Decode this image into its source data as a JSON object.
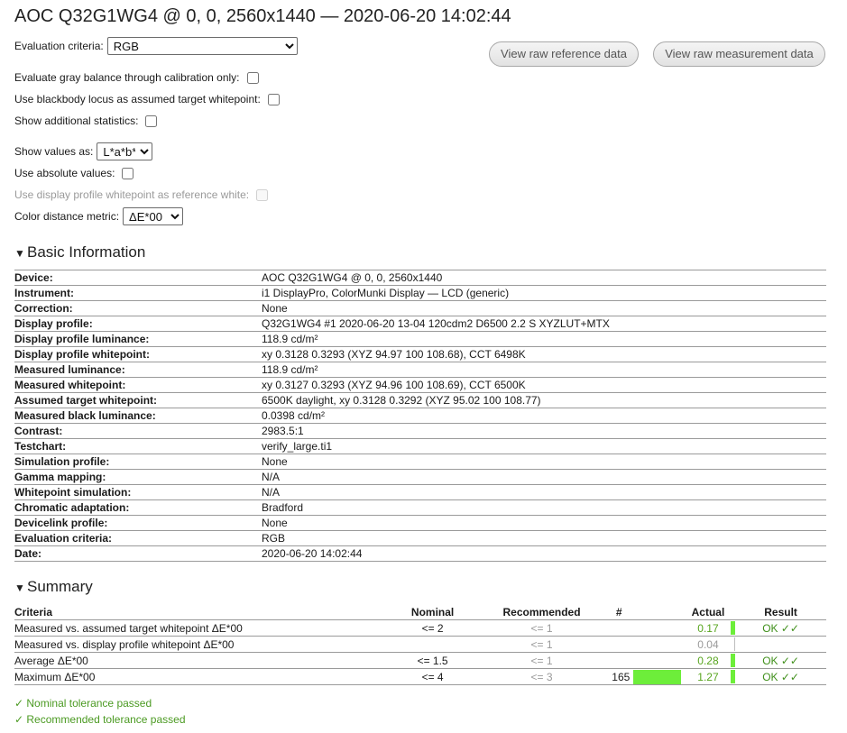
{
  "title": "AOC Q32G1WG4 @ 0, 0, 2560x1440 — 2020-06-20 14:02:44",
  "controls": {
    "evaluation_label": "Evaluation criteria:",
    "evaluation_value": "RGB",
    "gray_balance_label": "Evaluate gray balance through calibration only:",
    "blackbody_label": "Use blackbody locus as assumed target whitepoint:",
    "additional_stats_label": "Show additional statistics:",
    "show_values_label": "Show values as:",
    "show_values_value": "L*a*b*",
    "absolute_label": "Use absolute values:",
    "display_profile_wp_label": "Use display profile whitepoint as reference white:",
    "color_distance_label": "Color distance metric:",
    "color_distance_value": "ΔE*00"
  },
  "buttons": {
    "raw_reference": "View raw reference data",
    "raw_measurement": "View raw measurement data"
  },
  "basic": {
    "heading": "Basic Information",
    "rows": [
      {
        "k": "Device:",
        "v": "AOC Q32G1WG4 @ 0, 0, 2560x1440"
      },
      {
        "k": "Instrument:",
        "v": "i1 DisplayPro, ColorMunki Display — LCD (generic)"
      },
      {
        "k": "Correction:",
        "v": "None"
      },
      {
        "k": "Display profile:",
        "v": "Q32G1WG4 #1 2020-06-20 13-04 120cdm2 D6500 2.2 S XYZLUT+MTX"
      },
      {
        "k": "Display profile luminance:",
        "v": "118.9 cd/m²"
      },
      {
        "k": "Display profile whitepoint:",
        "v": "xy 0.3128 0.3293 (XYZ 94.97 100 108.68), CCT 6498K"
      },
      {
        "k": "Measured luminance:",
        "v": "118.9 cd/m²"
      },
      {
        "k": "Measured whitepoint:",
        "v": "xy 0.3127 0.3293 (XYZ 94.96 100 108.69), CCT 6500K"
      },
      {
        "k": "Assumed target whitepoint:",
        "v": "6500K daylight, xy 0.3128 0.3292 (XYZ 95.02 100 108.77)"
      },
      {
        "k": "Measured black luminance:",
        "v": "0.0398 cd/m²"
      },
      {
        "k": "Contrast:",
        "v": "2983.5:1"
      },
      {
        "k": "Testchart:",
        "v": "verify_large.ti1"
      },
      {
        "k": "Simulation profile:",
        "v": "None"
      },
      {
        "k": "Gamma mapping:",
        "v": "N/A"
      },
      {
        "k": "Whitepoint simulation:",
        "v": "N/A"
      },
      {
        "k": "Chromatic adaptation:",
        "v": "Bradford"
      },
      {
        "k": "Devicelink profile:",
        "v": "None"
      },
      {
        "k": "Evaluation criteria:",
        "v": "RGB"
      },
      {
        "k": "Date:",
        "v": "2020-06-20 14:02:44"
      }
    ]
  },
  "summary": {
    "heading": "Summary",
    "headers": {
      "criteria": "Criteria",
      "nominal": "Nominal",
      "recommended": "Recommended",
      "count": "#",
      "actual": "Actual",
      "result": "Result"
    },
    "rows": [
      {
        "criteria": "Measured vs. assumed target whitepoint ΔE*00",
        "nominal": "<= 2",
        "recommended": "<= 1",
        "count": "",
        "bar_fraction": 0,
        "actual": "0.17",
        "marker": "fill",
        "result": "OK ✓✓"
      },
      {
        "criteria": "Measured vs. display profile whitepoint ΔE*00",
        "nominal": "",
        "recommended": "<= 1",
        "count": "",
        "bar_fraction": 0,
        "actual": "0.04",
        "marker": "line",
        "result": ""
      },
      {
        "criteria": "Average ΔE*00",
        "nominal": "<= 1.5",
        "recommended": "<= 1",
        "count": "",
        "bar_fraction": 0,
        "actual": "0.28",
        "marker": "fill",
        "result": "OK ✓✓"
      },
      {
        "criteria": "Maximum ΔE*00",
        "nominal": "<= 4",
        "recommended": "<= 3",
        "count": "165",
        "bar_fraction": 1,
        "actual": "1.27",
        "marker": "fill",
        "result": "OK ✓✓"
      }
    ],
    "nominal_passed": "✓ Nominal tolerance passed",
    "recommended_passed": "✓ Recommended tolerance passed"
  },
  "colors": {
    "pass_green": "#58a51f",
    "bar_green": "#6dee3a",
    "muted_grey": "#9a9a9a"
  }
}
